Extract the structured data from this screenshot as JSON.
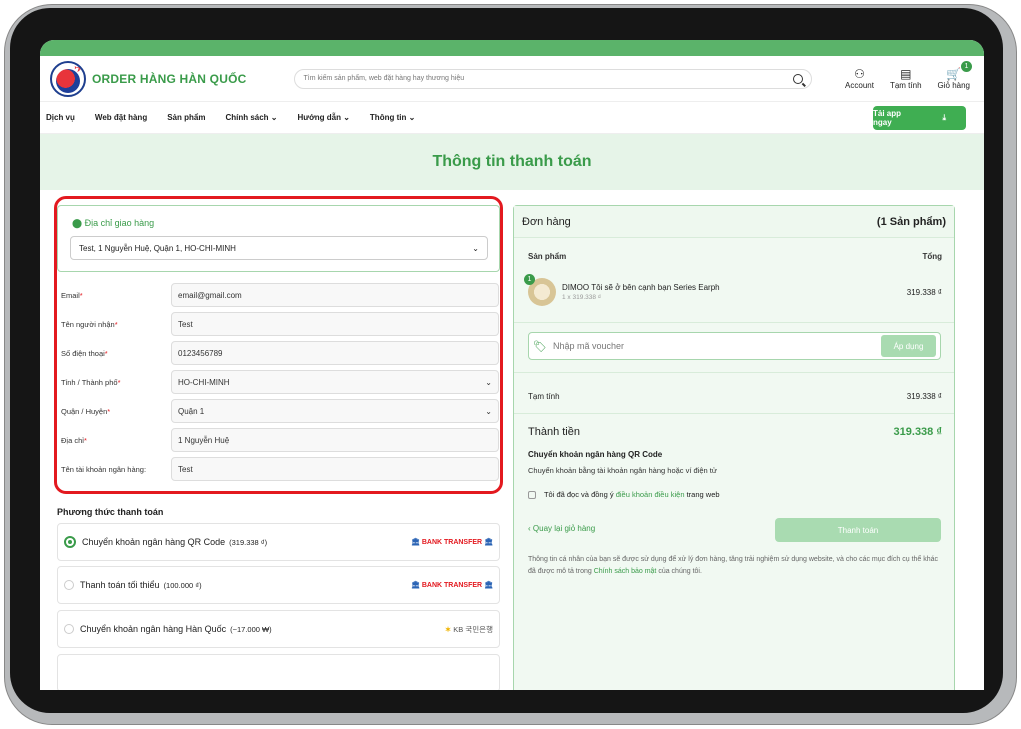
{
  "header": {
    "brand": "ORDER HÀNG HÀN QUỐC",
    "search_placeholder": "Tìm kiếm sản phẩm, web đặt hàng hay thương hiệu",
    "account": "Account",
    "subtotal": "Tạm tính",
    "cart": "Giỏ hàng",
    "cart_count": "1"
  },
  "nav": {
    "items": [
      "Dịch vụ",
      "Web đặt hàng",
      "Sản phẩm",
      "Chính sách",
      "Hướng dẫn",
      "Thông tin"
    ],
    "app_button": "Tải app ngay"
  },
  "page_title": "Thông tin thanh toán",
  "shipping": {
    "title": "Địa chỉ giao hàng",
    "selected": "Test, 1 Nguyễn Huệ, Quận 1, HO-CHI-MINH"
  },
  "form": {
    "fields": [
      {
        "label": "Email",
        "required": "*",
        "value": "email@gmail.com"
      },
      {
        "label": "Tên người nhận",
        "required": "*",
        "value": "Test"
      },
      {
        "label": "Số điện thoại",
        "required": "*",
        "value": "0123456789"
      },
      {
        "label": "Tỉnh / Thành phố",
        "required": "*",
        "value": "HO-CHI-MINH"
      },
      {
        "label": "Quận / Huyện",
        "required": "*",
        "value": "Quận 1"
      },
      {
        "label": "Địa chỉ",
        "required": "*",
        "value": "1 Nguyễn Huệ"
      },
      {
        "label": "Tên tài khoản ngân hàng:",
        "required": "",
        "value": "Test"
      }
    ]
  },
  "payment": {
    "title": "Phương thức thanh toán",
    "methods": [
      {
        "label": "Chuyển khoản ngân hàng QR Code",
        "amount": "(319.338 ₫)",
        "logo": "BANK TRANSFER"
      },
      {
        "label": "Thanh toán tối thiểu",
        "amount": "(100.000 ₫)",
        "logo": "BANK TRANSFER"
      },
      {
        "label": "Chuyển khoản ngân hàng Hàn Quốc",
        "amount": "(~17.000 ₩)",
        "logo": "KB 국민은행"
      }
    ]
  },
  "order": {
    "title": "Đơn hàng",
    "count": "(1 Sản phẩm)",
    "col_product": "Sản phẩm",
    "col_total": "Tổng",
    "product_name": "DIMOO Tôi sẽ ở bên cạnh bạn Series Earph",
    "product_qty": "1 x 319.338 ₫",
    "product_total": "319.338 ₫",
    "product_badge": "1",
    "voucher_placeholder": "Nhập mã voucher",
    "voucher_button": "Áp dụng",
    "subtotal_label": "Tạm tính",
    "subtotal_value": "319.338 ₫",
    "total_label": "Thành tiền",
    "total_value": "319.338 ₫",
    "method_title": "Chuyển khoản ngân hàng QR Code",
    "method_desc": "Chuyển khoản bằng tài khoản ngân hàng hoặc ví điện tử",
    "agree_prefix": "Tôi đã đọc và đồng ý",
    "agree_link": "điều khoản điều kiện",
    "agree_suffix": "trang web",
    "back_link": "Quay lại giỏ hàng",
    "checkout_button": "Thanh toán",
    "privacy_text": "Thông tin cá nhân của bạn sẽ được sử dụng để xử lý đơn hàng, tăng trải nghiệm sử dụng website, và cho các mục đích cụ thể khác đã được mô tả trong",
    "privacy_link": "Chính sách bảo mật",
    "privacy_suffix": "của chúng tôi."
  }
}
